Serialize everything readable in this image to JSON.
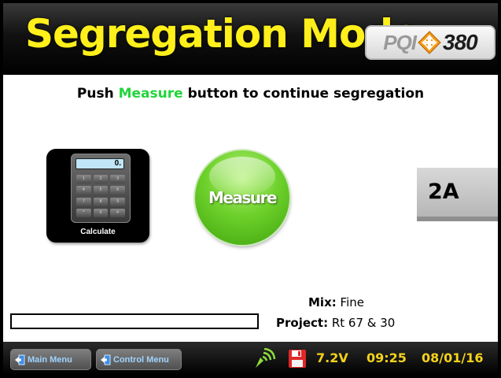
{
  "header": {
    "title": "Segregation Mode",
    "logo": {
      "left_text": "PQI",
      "model": "380",
      "icon": "diamond-arrows-icon"
    }
  },
  "main": {
    "instruction": {
      "prefix": "Push ",
      "highlight": "Measure",
      "suffix": " button to continue segregation",
      "highlight_color": "#22d53a"
    },
    "calculate": {
      "label": "Calculate",
      "screen": "0.",
      "keys": [
        "1",
        "2",
        "3",
        "4",
        "5",
        "6",
        "7",
        "8",
        "9",
        "*",
        "0",
        "#"
      ]
    },
    "measure_button": {
      "label": "Measure"
    },
    "position_badge": "2A",
    "mix": {
      "label": "Mix:",
      "value": "Fine"
    },
    "project": {
      "label": "Project:",
      "value": "Rt 67 & 30"
    },
    "progress": 0
  },
  "footer": {
    "main_menu": "Main Menu",
    "control_menu": "Control Menu",
    "icons": [
      "signal-icon",
      "save-disk-icon"
    ],
    "voltage": "7.2V",
    "time": "09:25",
    "date": "08/01/16"
  },
  "colors": {
    "title": "#ffef1a",
    "status": "#f4d21a",
    "measure": "#6ed12b"
  }
}
